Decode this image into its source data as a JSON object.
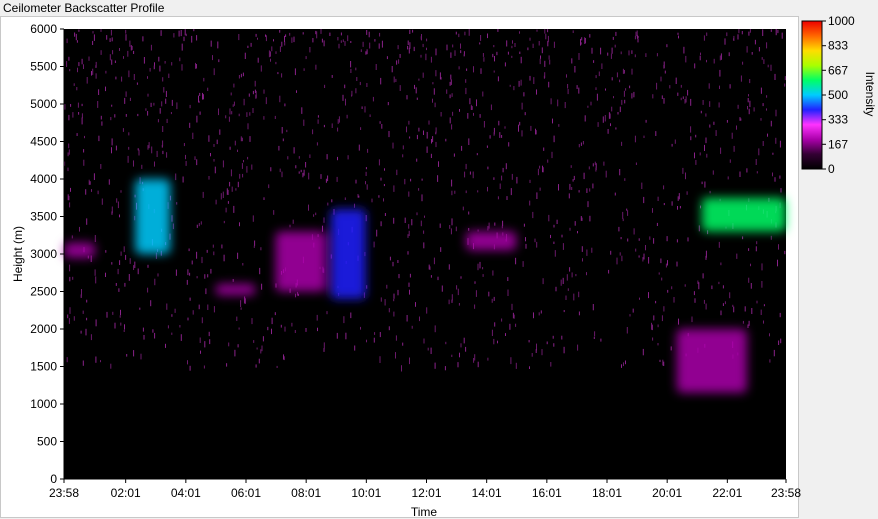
{
  "window": {
    "title": "Ceilometer Backscatter Profile"
  },
  "chart_data": {
    "type": "heatmap",
    "title": "",
    "xlabel": "Time",
    "ylabel": "Height (m)",
    "ylim": [
      0,
      6000
    ],
    "yticks": [
      0,
      500,
      1000,
      1500,
      2000,
      2500,
      3000,
      3500,
      4000,
      4500,
      5000,
      5500,
      6000
    ],
    "xticks": [
      "23:58",
      "02:01",
      "04:01",
      "06:01",
      "08:01",
      "10:01",
      "12:01",
      "14:01",
      "16:01",
      "18:01",
      "20:01",
      "22:01",
      "23:58"
    ],
    "colorbar": {
      "label": "Intensity",
      "range": [
        0,
        1000
      ],
      "ticks": [
        0,
        167,
        333,
        500,
        667,
        833,
        1000
      ],
      "colors": [
        "#000000",
        "#330033",
        "#aa00aa",
        "#ff33ff",
        "#2222ff",
        "#00ccff",
        "#00ff66",
        "#aaff00",
        "#ffdd00",
        "#ff6600",
        "#ee0000"
      ]
    },
    "features": [
      {
        "name": "",
        "x": [
          "23:58",
          "01:00"
        ],
        "y": [
          2950,
          3150
        ],
        "intensity": 220
      },
      {
        "name": "",
        "x": [
          "02:20",
          "03:30"
        ],
        "y": [
          3000,
          4000
        ],
        "intensity": 520
      },
      {
        "name": "",
        "x": [
          "05:00",
          "06:20"
        ],
        "y": [
          2450,
          2600
        ],
        "intensity": 200
      },
      {
        "name": "",
        "x": [
          "07:00",
          "08:40"
        ],
        "y": [
          2500,
          3300
        ],
        "intensity": 240
      },
      {
        "name": "",
        "x": [
          "08:50",
          "10:00"
        ],
        "y": [
          2400,
          3600
        ],
        "intensity": 380
      },
      {
        "name": "",
        "x": [
          "13:20",
          "15:00"
        ],
        "y": [
          3050,
          3300
        ],
        "intensity": 180
      },
      {
        "name": "",
        "x": [
          "21:10",
          "23:58"
        ],
        "y": [
          3300,
          3750
        ],
        "intensity": 560
      },
      {
        "name": "",
        "x": [
          "20:20",
          "22:40"
        ],
        "y": [
          1150,
          2000
        ],
        "intensity": 190
      }
    ]
  }
}
